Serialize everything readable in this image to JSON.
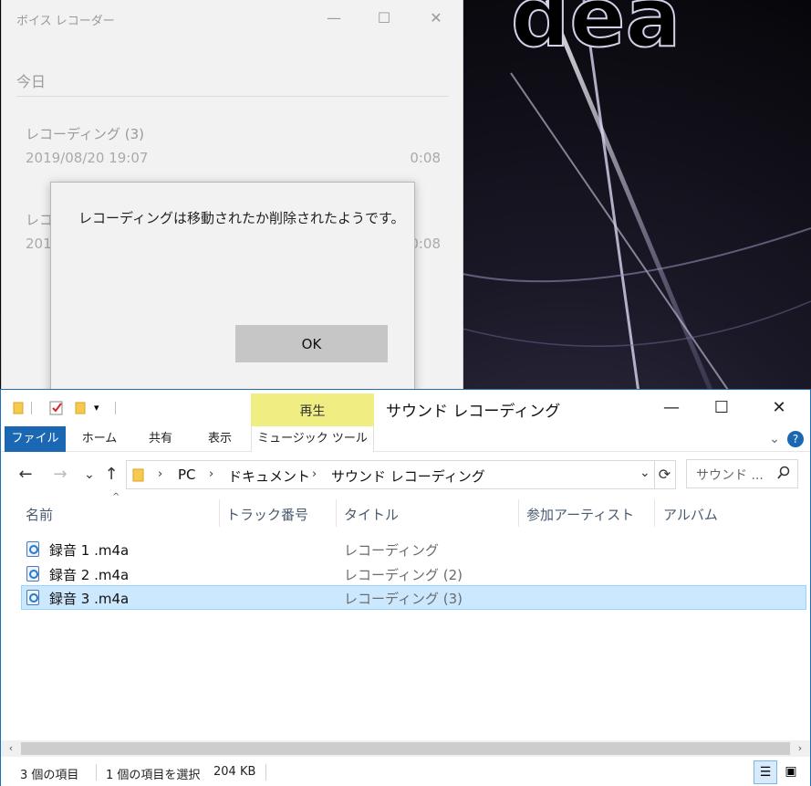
{
  "voice_recorder": {
    "title": "ボイス レコーダー",
    "controls": {
      "minimize": "—",
      "maximize": "☐",
      "close": "✕"
    },
    "section": "今日",
    "recordings": [
      {
        "title": "レコーディング (3)",
        "date": "2019/08/20 19:07",
        "duration": "0:08"
      },
      {
        "title": "レコ",
        "date": "201",
        "duration": "0:08"
      }
    ]
  },
  "dialog": {
    "message": "レコーディングは移動されたか削除されたようです。",
    "ok_label": "OK"
  },
  "explorer": {
    "quick_access": {
      "pin_icon": "folder-icon",
      "check_icon": "checkmark-icon",
      "dropdown": "▾"
    },
    "context_tab": "再生",
    "title": "サウンド レコーディング",
    "controls": {
      "minimize": "—",
      "maximize": "☐",
      "close": "✕"
    },
    "ribbon": {
      "file": "ファイル",
      "home": "ホーム",
      "share": "共有",
      "view": "表示",
      "music_tools": "ミュージック ツール"
    },
    "nav": {
      "back": "←",
      "forward": "→",
      "recent": "⌄",
      "up": "↑"
    },
    "breadcrumb": [
      "PC",
      "ドキュメント",
      "サウンド レコーディング"
    ],
    "search_placeholder": "サウンド ...",
    "columns": {
      "name": "名前",
      "track": "トラック番号",
      "title": "タイトル",
      "artist": "参加アーティスト",
      "album": "アルバム"
    },
    "files": [
      {
        "name": "録音 1 .m4a",
        "title": "レコーディング",
        "selected": false
      },
      {
        "name": "録音 2 .m4a",
        "title": "レコーディング (2)",
        "selected": false
      },
      {
        "name": "録音 3 .m4a",
        "title": "レコーディング (3)",
        "selected": true
      }
    ],
    "status": {
      "count": "3 個の項目",
      "selected": "1 個の項目を選択",
      "size": "204 KB"
    },
    "colors": {
      "accent": "#1a67b4",
      "context_tab": "#f0ee82",
      "selection": "#cce8ff"
    }
  }
}
